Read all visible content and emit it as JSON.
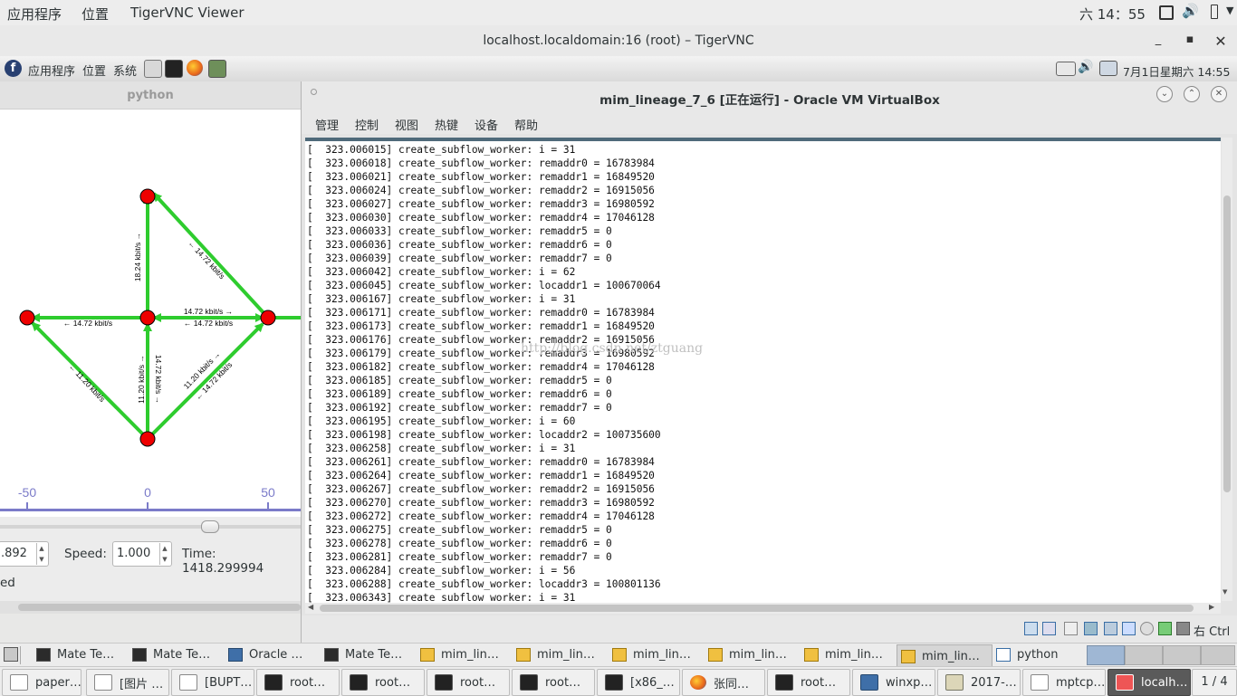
{
  "host_bar": {
    "apps": "应用程序",
    "places": "位置",
    "app_name": "TigerVNC Viewer",
    "clock": "六 14：55"
  },
  "vnc_window": {
    "title": "localhost.localdomain:16 (root) – TigerVNC"
  },
  "remote_panel": {
    "apps": "应用程序",
    "places": "位置",
    "system": "系统",
    "clock": "7月1日星期六 14:55"
  },
  "python_app": {
    "title": "python",
    "axis_ticks": [
      "-50",
      "0",
      "50"
    ],
    "edge_labels": [
      "18.24 kbit/s →",
      "← 14.72 kbit/s",
      "← 14.72 kbit/s",
      "14.72 kbit/s →",
      "← 14.72 kbit/s",
      "← 11.20 kbit/s",
      "11.20 kbit/s →",
      "14.72 kbit/s →",
      "11.20 kbit/s →",
      "← 14.72 kbit/s"
    ],
    "step_value": ".892",
    "speed_label": "Speed:",
    "speed_value": "1.000",
    "time_text": "Time: 1418.299994",
    "status_text": "ed"
  },
  "vbox": {
    "title": "mim_lineage_7_6 [正在运行] - Oracle VM VirtualBox",
    "menu": [
      "管理",
      "控制",
      "视图",
      "热键",
      "设备",
      "帮助"
    ],
    "host_key": "右 Ctrl",
    "watermark": "http://blog.csdn.net/ztguang",
    "terminal_lines": [
      "[  323.006015] create_subflow_worker: i = 31",
      "[  323.006018] create_subflow_worker: remaddr0 = 16783984",
      "[  323.006021] create_subflow_worker: remaddr1 = 16849520",
      "[  323.006024] create_subflow_worker: remaddr2 = 16915056",
      "[  323.006027] create_subflow_worker: remaddr3 = 16980592",
      "[  323.006030] create_subflow_worker: remaddr4 = 17046128",
      "[  323.006033] create_subflow_worker: remaddr5 = 0",
      "[  323.006036] create_subflow_worker: remaddr6 = 0",
      "[  323.006039] create_subflow_worker: remaddr7 = 0",
      "[  323.006042] create_subflow_worker: i = 62",
      "[  323.006045] create_subflow_worker: locaddr1 = 100670064",
      "[  323.006167] create_subflow_worker: i = 31",
      "[  323.006171] create_subflow_worker: remaddr0 = 16783984",
      "[  323.006173] create_subflow_worker: remaddr1 = 16849520",
      "[  323.006176] create_subflow_worker: remaddr2 = 16915056",
      "[  323.006179] create_subflow_worker: remaddr3 = 16980592",
      "[  323.006182] create_subflow_worker: remaddr4 = 17046128",
      "[  323.006185] create_subflow_worker: remaddr5 = 0",
      "[  323.006189] create_subflow_worker: remaddr6 = 0",
      "[  323.006192] create_subflow_worker: remaddr7 = 0",
      "[  323.006195] create_subflow_worker: i = 60",
      "[  323.006198] create_subflow_worker: locaddr2 = 100735600",
      "[  323.006258] create_subflow_worker: i = 31",
      "[  323.006261] create_subflow_worker: remaddr0 = 16783984",
      "[  323.006264] create_subflow_worker: remaddr1 = 16849520",
      "[  323.006267] create_subflow_worker: remaddr2 = 16915056",
      "[  323.006270] create_subflow_worker: remaddr3 = 16980592",
      "[  323.006272] create_subflow_worker: remaddr4 = 17046128",
      "[  323.006275] create_subflow_worker: remaddr5 = 0",
      "[  323.006278] create_subflow_worker: remaddr6 = 0",
      "[  323.006281] create_subflow_worker: remaddr7 = 0",
      "[  323.006284] create_subflow_worker: i = 56",
      "[  323.006288] create_subflow_worker: locaddr3 = 100801136",
      "[  323.006343] create_subflow_worker: i = 31"
    ]
  },
  "taskbar_remote": [
    "Mate Te…",
    "Mate Te…",
    "Oracle …",
    "Mate Te…",
    "mim_lin…",
    "mim_lin…",
    "mim_lin…",
    "mim_lin…",
    "mim_lin…",
    "mim_lin…",
    "python"
  ],
  "taskbar_host": [
    "paper…",
    "[图片 …",
    "[BUPT…",
    "root…",
    "root…",
    "root…",
    "root…",
    "[x86_…",
    "张同…",
    "root…",
    "winxp…",
    "2017-…",
    "mptcp…",
    "localh…"
  ],
  "workspace": "1 / 4",
  "colors": {
    "node": "#ee0000",
    "edge": "#2ecc2e",
    "axis": "#7b7bc9",
    "term_border": "#4f6a7a"
  }
}
